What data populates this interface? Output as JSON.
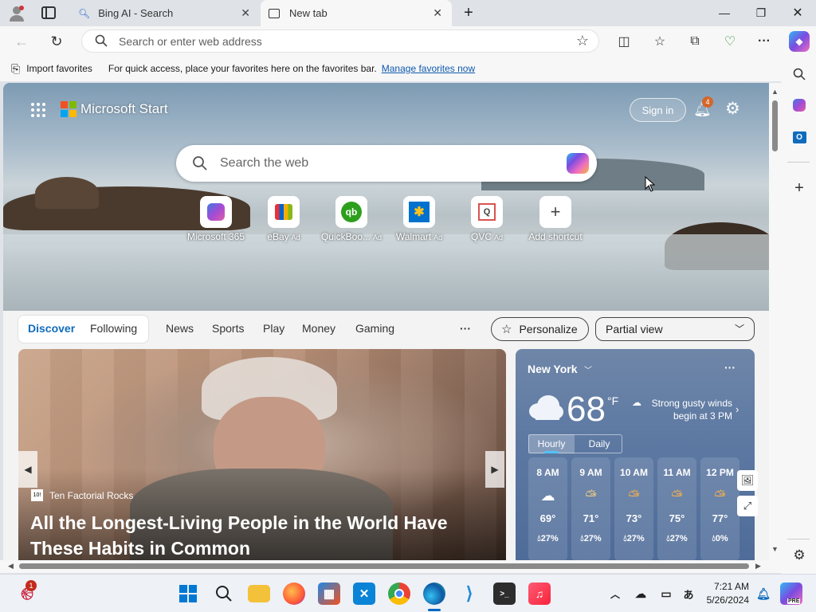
{
  "tabs": [
    {
      "label": "Bing AI - Search",
      "icon": "search-icon"
    },
    {
      "label": "New tab",
      "icon": "new-tab-icon"
    }
  ],
  "toolbar": {
    "address_placeholder": "Search or enter web address"
  },
  "favorites_bar": {
    "import_label": "Import favorites",
    "message": "For quick access, place your favorites here on the favorites bar.",
    "manage_link": "Manage favorites now"
  },
  "newtab": {
    "brand": "Microsoft Start",
    "sign_in": "Sign in",
    "notification_count": "4",
    "search_placeholder": "Search the web",
    "shortcuts": [
      {
        "label": "Microsoft 365",
        "ad": "",
        "icon": "microsoft365-icon",
        "color": "#7b4fd6"
      },
      {
        "label": "eBay",
        "ad": "Ad",
        "icon": "ebay-icon",
        "color": "#e53238"
      },
      {
        "label": "QuickBoo...",
        "ad": "Ad",
        "icon": "quickbooks-icon",
        "color": "#2ca01c"
      },
      {
        "label": "Walmart",
        "ad": "Ad",
        "icon": "walmart-icon",
        "color": "#0071ce"
      },
      {
        "label": "QVC",
        "ad": "Ad",
        "icon": "qvc-icon",
        "color": "#d9534f"
      },
      {
        "label": "Add shortcut",
        "ad": "",
        "icon": "plus-icon",
        "color": "#444444"
      }
    ]
  },
  "feed_nav": {
    "items": [
      "Discover",
      "Following",
      "News",
      "Sports",
      "Play",
      "Money",
      "Gaming"
    ],
    "more": "···",
    "personalize": "Personalize",
    "view": "Partial view"
  },
  "article": {
    "source": "Ten Factorial Rocks",
    "source_logo": "10!",
    "title": "All the Longest-Living People in the World Have These Habits in Common"
  },
  "weather": {
    "location": "New York",
    "temp": "68",
    "unit": "°F",
    "alert": "Strong gusty winds begin at 3 PM",
    "tabs": [
      "Hourly",
      "Daily"
    ],
    "hourly": [
      {
        "time": "8 AM",
        "temp": "69°",
        "precip": "27%",
        "icon": "cloud-icon"
      },
      {
        "time": "9 AM",
        "temp": "71°",
        "precip": "27%",
        "icon": "partly-cloudy-icon"
      },
      {
        "time": "10 AM",
        "temp": "73°",
        "precip": "27%",
        "icon": "partly-sunny-icon"
      },
      {
        "time": "11 AM",
        "temp": "75°",
        "precip": "27%",
        "icon": "partly-sunny-icon"
      },
      {
        "time": "12 PM",
        "temp": "77°",
        "precip": "0%",
        "icon": "partly-sunny-icon"
      }
    ]
  },
  "taskbar": {
    "notification_badge": "1",
    "time": "7:21 AM",
    "date": "5/26/2024",
    "copilot_badge": "PRE"
  }
}
